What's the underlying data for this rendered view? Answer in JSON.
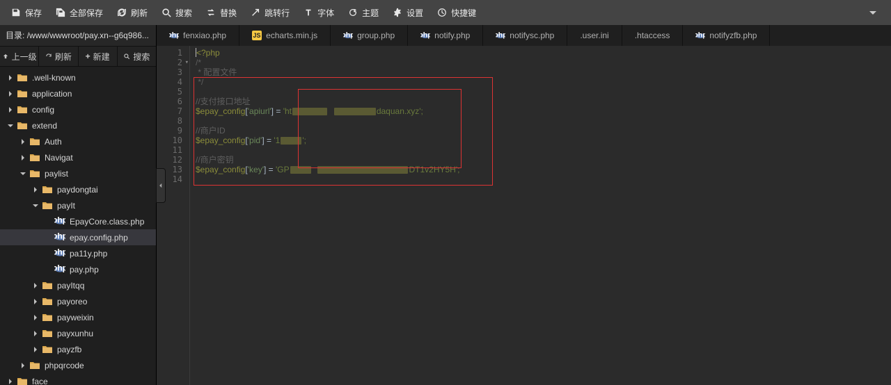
{
  "toolbar": {
    "save": "保存",
    "saveAll": "全部保存",
    "refresh": "刷新",
    "search": "搜索",
    "replace": "替换",
    "jump": "跳转行",
    "font": "字体",
    "theme": "主题",
    "settings": "设置",
    "shortcut": "快捷键"
  },
  "pathbar": {
    "label": "目录:",
    "path": "/www/wwwroot/pay.xn--g6q986..."
  },
  "sidetools": {
    "up": "上一级",
    "refresh": "刷新",
    "new": "新建",
    "search": "搜索"
  },
  "tree": [
    {
      "type": "folder",
      "name": ".well-known",
      "depth": 0,
      "state": "closed"
    },
    {
      "type": "folder",
      "name": "application",
      "depth": 0,
      "state": "closed"
    },
    {
      "type": "folder",
      "name": "config",
      "depth": 0,
      "state": "closed"
    },
    {
      "type": "folder",
      "name": "extend",
      "depth": 0,
      "state": "open"
    },
    {
      "type": "folder",
      "name": "Auth",
      "depth": 1,
      "state": "closed"
    },
    {
      "type": "folder",
      "name": "Navigat",
      "depth": 1,
      "state": "closed"
    },
    {
      "type": "folder",
      "name": "paylist",
      "depth": 1,
      "state": "open"
    },
    {
      "type": "folder",
      "name": "paydongtai",
      "depth": 2,
      "state": "closed"
    },
    {
      "type": "folder",
      "name": "payIt",
      "depth": 2,
      "state": "open"
    },
    {
      "type": "file",
      "name": "EpayCore.class.php",
      "depth": 3,
      "icon": "php"
    },
    {
      "type": "file",
      "name": "epay.config.php",
      "depth": 3,
      "icon": "php",
      "active": true
    },
    {
      "type": "file",
      "name": "pa11y.php",
      "depth": 3,
      "icon": "php"
    },
    {
      "type": "file",
      "name": "pay.php",
      "depth": 3,
      "icon": "php"
    },
    {
      "type": "folder",
      "name": "payItqq",
      "depth": 2,
      "state": "closed"
    },
    {
      "type": "folder",
      "name": "payoreo",
      "depth": 2,
      "state": "closed"
    },
    {
      "type": "folder",
      "name": "payweixin",
      "depth": 2,
      "state": "closed"
    },
    {
      "type": "folder",
      "name": "payxunhu",
      "depth": 2,
      "state": "closed"
    },
    {
      "type": "folder",
      "name": "payzfb",
      "depth": 2,
      "state": "closed"
    },
    {
      "type": "folder",
      "name": "phpqrcode",
      "depth": 1,
      "state": "closed"
    },
    {
      "type": "folder",
      "name": "face",
      "depth": 0,
      "state": "closed"
    }
  ],
  "tabs": [
    {
      "label": "fenxiao.php",
      "icon": "php"
    },
    {
      "label": "echarts.min.js",
      "icon": "js"
    },
    {
      "label": "group.php",
      "icon": "php"
    },
    {
      "label": "notify.php",
      "icon": "php"
    },
    {
      "label": "notifysc.php",
      "icon": "php"
    },
    {
      "label": ".user.ini",
      "icon": "none"
    },
    {
      "label": ".htaccess",
      "icon": "none"
    },
    {
      "label": "notifyzfb.php",
      "icon": "php"
    }
  ],
  "code": {
    "l1_a": "<?php",
    "l2": "/*",
    "l3": " * 配置文件",
    "l4": " */",
    "l6": "//支付接口地址",
    "l7_var": "$epay_config",
    "l7_key": "'apiurl'",
    "l7_pre": "'ht",
    "l7_post": "daquan.xyz';",
    "l9": "//商户ID",
    "l10_var": "$epay_config",
    "l10_key": "'pid'",
    "l10_pre": "'1",
    "l10_post": "';",
    "l12": "//商户密钥",
    "l13_var": "$epay_config",
    "l13_key": "'key'",
    "l13_pre": "'GP",
    "l13_post": "DT1v2HY5H';"
  },
  "line_numbers": [
    "1",
    "2",
    "3",
    "4",
    "5",
    "6",
    "7",
    "8",
    "9",
    "10",
    "11",
    "12",
    "13",
    "14"
  ]
}
